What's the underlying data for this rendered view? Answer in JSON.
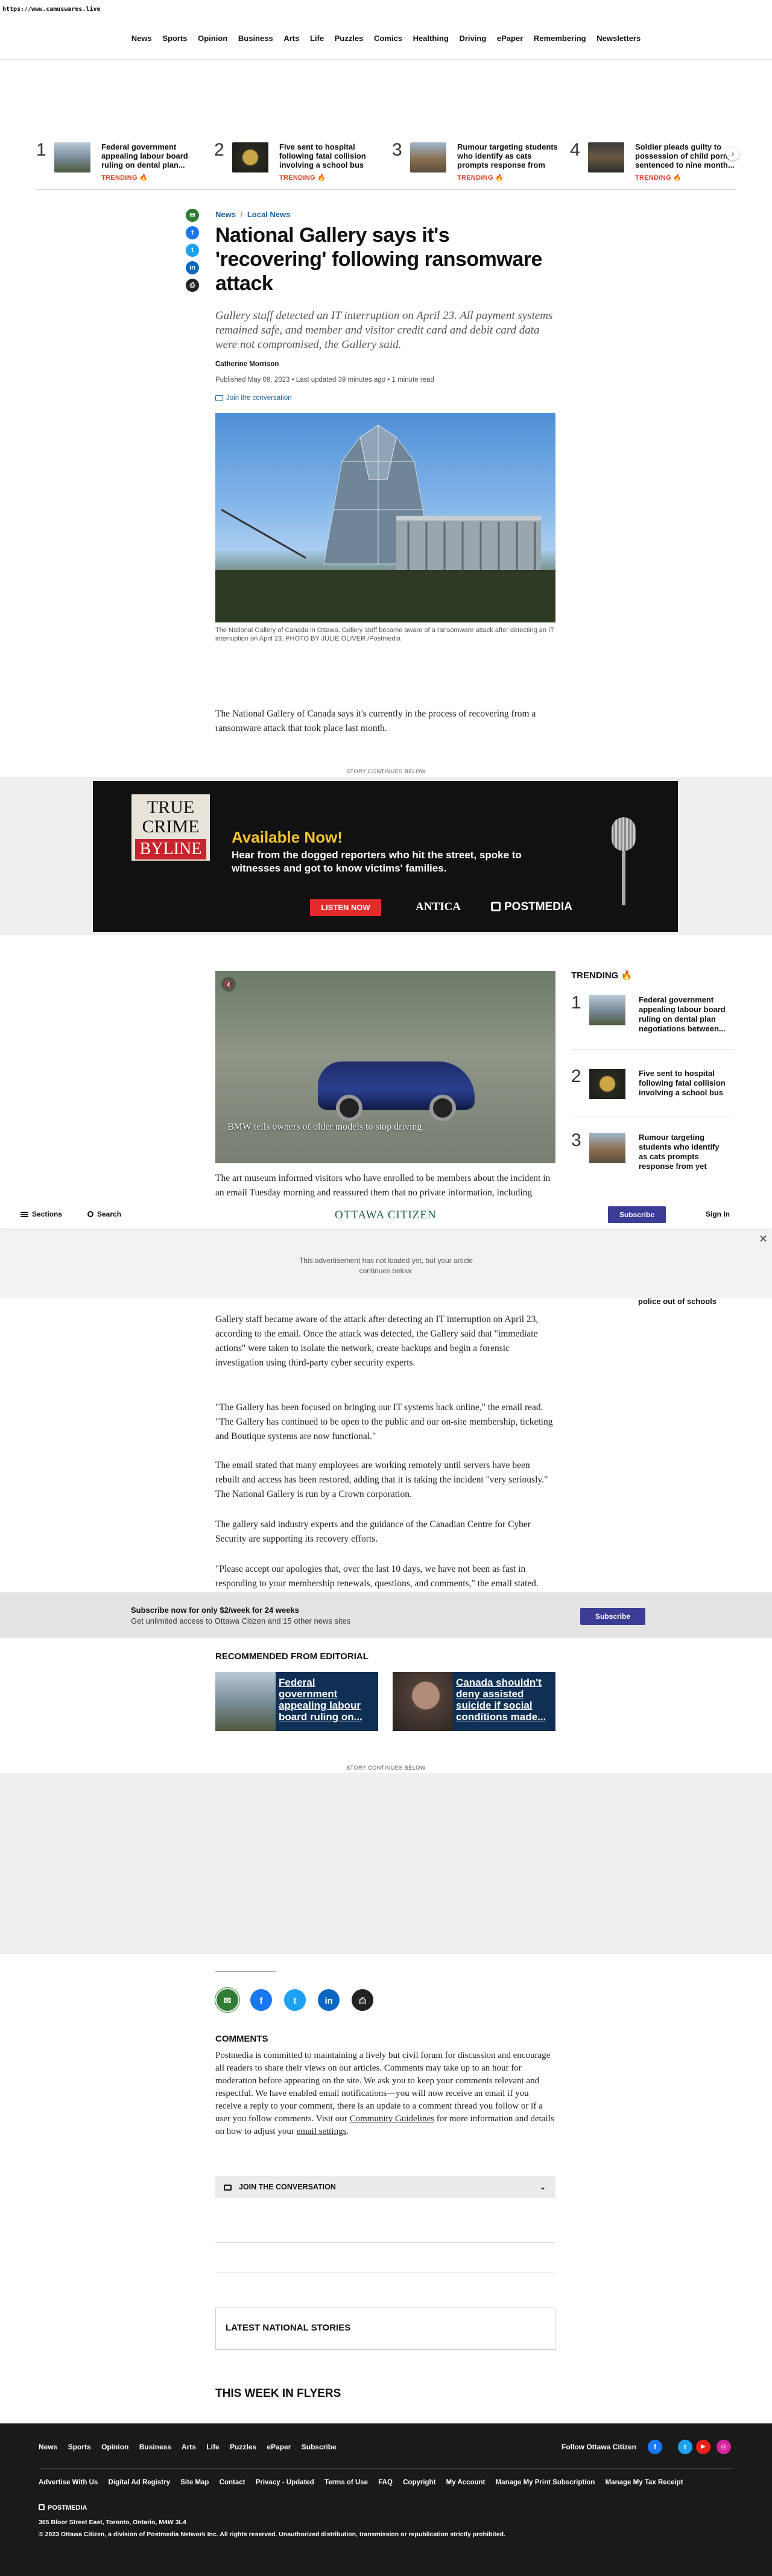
{
  "url_bar": "https://www.camuswares.live",
  "nav": [
    "News",
    "Sports",
    "Opinion",
    "Business",
    "Arts",
    "Life",
    "Puzzles",
    "Comics",
    "Healthing",
    "Driving",
    "ePaper",
    "Remembering",
    "Newsletters"
  ],
  "trending_top": [
    {
      "num": "1",
      "text": "Federal government appealing labour board ruling on dental plan...",
      "tag": "TRENDING"
    },
    {
      "num": "2",
      "text": "Five sent to hospital following fatal collision involving a school bus",
      "tag": "TRENDING"
    },
    {
      "num": "3",
      "text": "Rumour targeting students who identify as cats prompts response from ye...",
      "tag": "TRENDING"
    },
    {
      "num": "4",
      "text": "Soldier pleads guilty to possession of child porn, sentenced to nine month...",
      "tag": "TRENDING"
    }
  ],
  "breadcrumb": {
    "news": "News",
    "sep": "/",
    "local": "Local News"
  },
  "headline": "National Gallery says it's 'recovering' following ransomware attack",
  "dek": "Gallery staff detected an IT interruption on April 23. All payment systems remained safe, and member and visitor credit card and debit card data were not compromised, the Gallery said.",
  "author": "Catherine Morrison",
  "published": "Published May 09, 2023 • Last updated 39 minutes ago • 1 minute read",
  "join": "Join the conversation",
  "photo_caption": "The National Gallery of Canada in Ottawa. Gallery staff became aware of a ransomware attack after detecting an IT interruption on April 23. PHOTO BY JULIE OLIVER /Postmedia",
  "p1": "The National Gallery of Canada says it's currently in the process of recovering from a ransomware attack that took place last month.",
  "story_continues": "STORY CONTINUES BELOW",
  "banner": {
    "logo1": "TRUE",
    "logo2": "CRIME",
    "logo3": "BYLINE",
    "avail": "Available Now!",
    "line": "Hear from the dogged reporters who hit the street, spoke to witnesses and got to know victims' families.",
    "listen": "LISTEN NOW",
    "antica": "ANTICA",
    "postmedia": "POSTMEDIA"
  },
  "video_caption": "BMW tells owners of older models to stop driving",
  "p2": "The art museum informed visitors who have enrolled to be members about the incident in an email Tuesday morning and reassured them that no private information, including",
  "sticky": {
    "sections": "Sections",
    "search": "Search",
    "logo": "OTTAWA CITIZEN",
    "subscribe": "Subscribe",
    "signin": "Sign In"
  },
  "ad_notice": "This advertisement has not loaded yet, but your article continues below.",
  "p3": "Gallery staff became aware of the attack after detecting an IT interruption on April 23, according to the email. Once the attack was detected, the Gallery said that \"immediate actions\" were taken to isolate the network, create backups and begin a forensic investigation using third-party cyber security experts.",
  "p4": "\"The Gallery has been focused on bringing our IT systems back online,\" the email read. \"The Gallery has continued to be open to the public and our on-site membership, ticketing and Boutique systems are now functional.\"",
  "p5": "The email stated that many employees are working remotely until servers have been rebuilt and access has been restored, adding that it is taking the incident \"very seriously.\" The National Gallery is run by a Crown corporation.",
  "p6": "The gallery said industry experts and the guidance of the Canadian Centre for Cyber Security are supporting its recovery efforts.",
  "p7": "\"Please accept our apologies that, over the last 10 days, we have not been as fast in responding to your membership renewals, questions, and comments,\" the email stated.",
  "trending_side": {
    "title": "TRENDING",
    "items": [
      {
        "num": "1",
        "text": "Federal government appealing labour board ruling on dental plan negotiations between..."
      },
      {
        "num": "2",
        "text": "Five sent to hospital following fatal collision involving a school bus"
      },
      {
        "num": "3",
        "text": "Rumour targeting students who identify as cats prompts response from yet another Canadian school"
      }
    ],
    "peek": "police out of schools"
  },
  "sub_bar": {
    "line1": "Subscribe now for only $2/week for 24 weeks",
    "line2": "Get unlimited access to Ottawa Citizen and 15 other news sites",
    "btn": "Subscribe"
  },
  "recommended": {
    "title": "RECOMMENDED FROM EDITORIAL",
    "items": [
      "Federal government appealing labour board ruling on...",
      "Canada shouldn't deny assisted suicide if social conditions made..."
    ]
  },
  "story_continues2": "STORY CONTINUES BELOW",
  "comments": {
    "title": "COMMENTS",
    "text": "Postmedia is committed to maintaining a lively but civil forum for discussion and encourage all readers to share their views on our articles. Comments may take up to an hour for moderation before appearing on the site. We ask you to keep your comments relevant and respectful. We have enabled email notifications—you will now receive an email if you receive a reply to your comment, there is an update to a comment thread you follow or if a user you follow comments. Visit our ",
    "guidelines": "Community Guidelines",
    "text2": " for more information and details on how to adjust your ",
    "settings": "email settings",
    "text3": ".",
    "join": "JOIN THE CONVERSATION"
  },
  "latest": "LATEST NATIONAL STORIES",
  "flyers": "THIS WEEK IN FLYERS",
  "footer": {
    "nav": [
      "News",
      "Sports",
      "Opinion",
      "Business",
      "Arts",
      "Life",
      "Puzzles",
      "ePaper",
      "Subscribe"
    ],
    "follow": "Follow Ottawa Citizen",
    "links": [
      "Advertise With Us",
      "Digital Ad Registry",
      "Site Map",
      "Contact",
      "Privacy - Updated",
      "Terms of Use",
      "FAQ",
      "Copyright",
      "My Account",
      "Manage My Print Subscription",
      "Manage My Tax Receipt"
    ],
    "brand": "POSTMEDIA",
    "address": "365 Bloor Street East, Toronto, Ontario, M4W 3L4",
    "copyright": "© 2023 Ottawa Citizen, a division of Postmedia Network Inc. All rights reserved. Unauthorized distribution, transmission or republication strictly prohibited."
  }
}
